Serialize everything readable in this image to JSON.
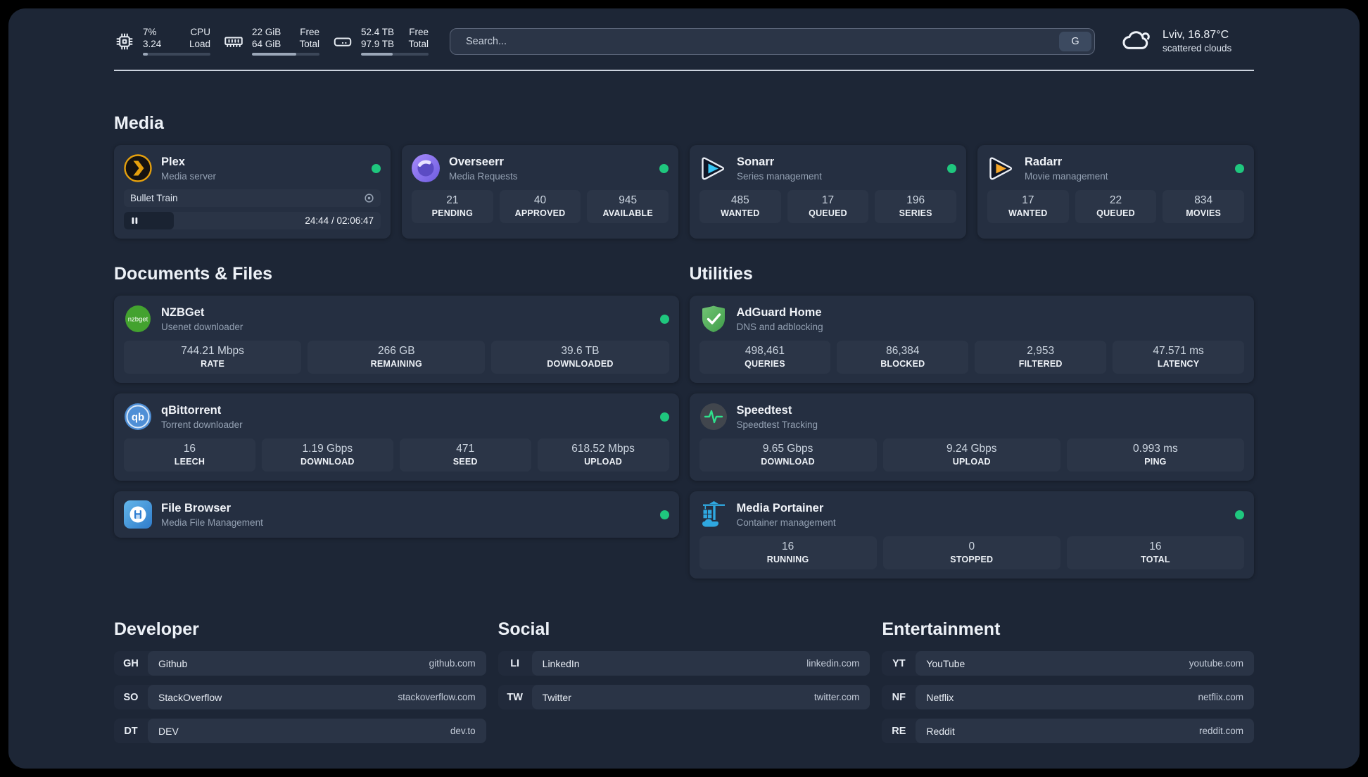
{
  "colors": {
    "accent_green": "#1fc77e",
    "panel_bg": "#1d2636",
    "card_bg": "#252f41"
  },
  "topbar": {
    "metrics": [
      {
        "name": "cpu",
        "values": [
          "7%",
          "3.24"
        ],
        "labels": [
          "CPU",
          "Load"
        ],
        "progress": "7%"
      },
      {
        "name": "memory",
        "values": [
          "22 GiB",
          "64 GiB"
        ],
        "labels": [
          "Free",
          "Total"
        ],
        "progress": "66%"
      },
      {
        "name": "storage",
        "values": [
          "52.4 TB",
          "97.9 TB"
        ],
        "labels": [
          "Free",
          "Total"
        ],
        "progress": "46.5%"
      }
    ],
    "search": {
      "placeholder": "Search...",
      "button_label": "G"
    },
    "weather": {
      "line1": "Lviv, 16.87°C",
      "line2": "scattered clouds"
    }
  },
  "media": {
    "title": "Media",
    "plex": {
      "name": "Plex",
      "subtitle": "Media server",
      "online": true,
      "now_playing": {
        "title": "Bullet Train",
        "time": "24:44 / 02:06:47",
        "progress": "19.5%"
      }
    },
    "cards": [
      {
        "name": "Overseerr",
        "subtitle": "Media Requests",
        "online": true,
        "stats": [
          {
            "value": "21",
            "label": "PENDING"
          },
          {
            "value": "40",
            "label": "APPROVED"
          },
          {
            "value": "945",
            "label": "AVAILABLE"
          }
        ]
      },
      {
        "name": "Sonarr",
        "subtitle": "Series management",
        "online": true,
        "stats": [
          {
            "value": "485",
            "label": "WANTED"
          },
          {
            "value": "17",
            "label": "QUEUED"
          },
          {
            "value": "196",
            "label": "SERIES"
          }
        ]
      },
      {
        "name": "Radarr",
        "subtitle": "Movie management",
        "online": true,
        "stats": [
          {
            "value": "17",
            "label": "WANTED"
          },
          {
            "value": "22",
            "label": "QUEUED"
          },
          {
            "value": "834",
            "label": "MOVIES"
          }
        ]
      }
    ]
  },
  "documents": {
    "title": "Documents & Files",
    "cards": [
      {
        "name": "NZBGet",
        "subtitle": "Usenet downloader",
        "online": true,
        "stats": [
          {
            "value": "744.21 Mbps",
            "label": "RATE"
          },
          {
            "value": "266 GB",
            "label": "REMAINING"
          },
          {
            "value": "39.6 TB",
            "label": "DOWNLOADED"
          }
        ]
      },
      {
        "name": "qBittorrent",
        "subtitle": "Torrent downloader",
        "online": true,
        "stats": [
          {
            "value": "16",
            "label": "LEECH"
          },
          {
            "value": "1.19 Gbps",
            "label": "DOWNLOAD"
          },
          {
            "value": "471",
            "label": "SEED"
          },
          {
            "value": "618.52 Mbps",
            "label": "UPLOAD"
          }
        ]
      },
      {
        "name": "File Browser",
        "subtitle": "Media File Management",
        "online": true,
        "stats": []
      }
    ]
  },
  "utilities": {
    "title": "Utilities",
    "cards": [
      {
        "name": "AdGuard Home",
        "subtitle": "DNS and adblocking",
        "online": false,
        "stats": [
          {
            "value": "498,461",
            "label": "QUERIES"
          },
          {
            "value": "86,384",
            "label": "BLOCKED"
          },
          {
            "value": "2,953",
            "label": "FILTERED"
          },
          {
            "value": "47.571 ms",
            "label": "LATENCY"
          }
        ]
      },
      {
        "name": "Speedtest",
        "subtitle": "Speedtest Tracking",
        "online": false,
        "stats": [
          {
            "value": "9.65 Gbps",
            "label": "DOWNLOAD"
          },
          {
            "value": "9.24 Gbps",
            "label": "UPLOAD"
          },
          {
            "value": "0.993 ms",
            "label": "PING"
          }
        ]
      },
      {
        "name": "Media Portainer",
        "subtitle": "Container management",
        "online": true,
        "stats": [
          {
            "value": "16",
            "label": "RUNNING"
          },
          {
            "value": "0",
            "label": "STOPPED"
          },
          {
            "value": "16",
            "label": "TOTAL"
          }
        ]
      }
    ]
  },
  "bookmarks": [
    {
      "title": "Developer",
      "links": [
        {
          "abbr": "GH",
          "name": "Github",
          "url": "github.com"
        },
        {
          "abbr": "SO",
          "name": "StackOverflow",
          "url": "stackoverflow.com"
        },
        {
          "abbr": "DT",
          "name": "DEV",
          "url": "dev.to"
        }
      ]
    },
    {
      "title": "Social",
      "links": [
        {
          "abbr": "LI",
          "name": "LinkedIn",
          "url": "linkedin.com"
        },
        {
          "abbr": "TW",
          "name": "Twitter",
          "url": "twitter.com"
        }
      ]
    },
    {
      "title": "Entertainment",
      "links": [
        {
          "abbr": "YT",
          "name": "YouTube",
          "url": "youtube.com"
        },
        {
          "abbr": "NF",
          "name": "Netflix",
          "url": "netflix.com"
        },
        {
          "abbr": "RE",
          "name": "Reddit",
          "url": "reddit.com"
        }
      ]
    }
  ]
}
